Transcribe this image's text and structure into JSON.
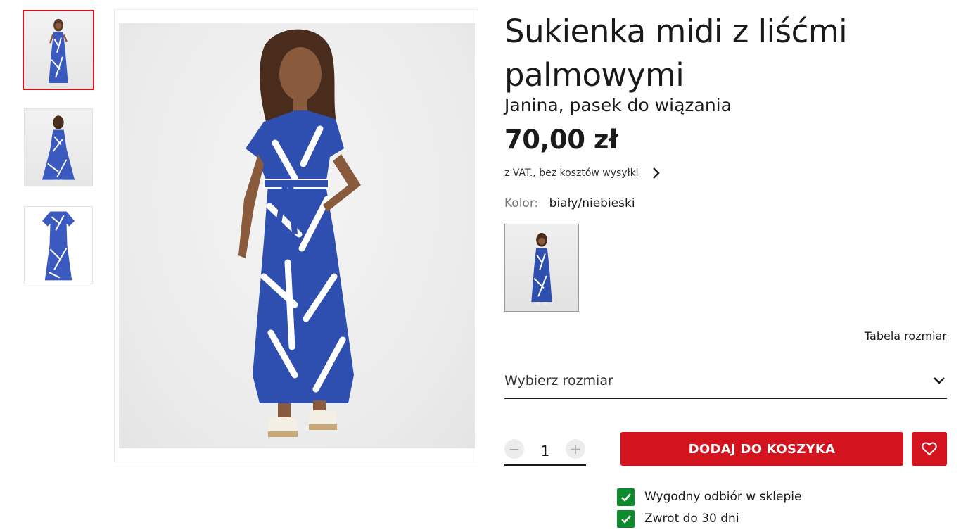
{
  "gallery": {
    "thumbnails": [
      {
        "alt": "front",
        "active": true
      },
      {
        "alt": "back",
        "active": false
      },
      {
        "alt": "flat",
        "active": false
      }
    ]
  },
  "product": {
    "title": "Sukienka midi z liśćmi palmowymi",
    "subtitle": "Janina, pasek do wiązania",
    "price": "70,00 zł",
    "vat_note": "z VAT., bez kosztów wysyłki",
    "color_label": "Kolor:",
    "color_value": "biały/niebieski"
  },
  "size": {
    "table_link": "Tabela rozmiar",
    "select_placeholder": "Wybierz rozmiar"
  },
  "cart": {
    "quantity": "1",
    "minus_symbol": "−",
    "plus_symbol": "+",
    "add_label": "DODAJ DO KOSZYKA"
  },
  "benefits": [
    {
      "text": "Wygodny odbiór w sklepie"
    },
    {
      "text": "Zwrot do 30 dni"
    }
  ],
  "colors": {
    "brand_red": "#d3141f",
    "check_green": "#0d8a2c",
    "dress_blue": "#2f4fb0"
  }
}
